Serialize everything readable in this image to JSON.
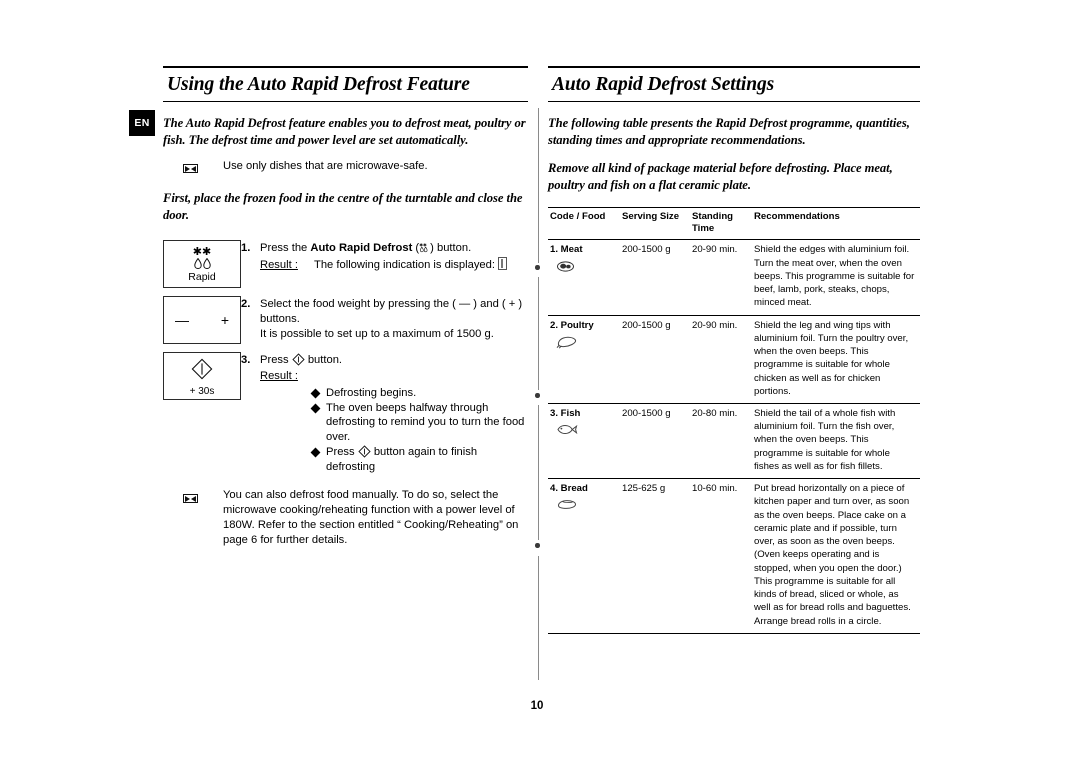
{
  "language_tab": "EN",
  "page_number": "10",
  "left_column": {
    "heading": "Using the Auto Rapid Defrost Feature",
    "intro_1": "The Auto Rapid Defrost feature enables you to defrost meat, poultry or fish. The defrost time and power level are set automatically.",
    "note_1": "Use only dishes that are microwave-safe.",
    "note_1_icon": "microwave-safe-dish-icon",
    "intro_2": "First, place the frozen food in the centre of the turntable and close the door.",
    "steps": [
      {
        "number": "1.",
        "button_icon": "auto-rapid-defrost-button",
        "button_caption": "Rapid",
        "text_before_bold": "Press the ",
        "bold_text": "Auto Rapid Defrost",
        "text_after_bold": " (",
        "text_end": ") button.",
        "result_label": "Result :",
        "result_text": "The following indication is displayed:",
        "result_icon": "lcd-display-glyph"
      },
      {
        "number": "2.",
        "button_icon": "minus-plus-button",
        "minus": "—",
        "plus": "+",
        "line_1a": "Select the food weight by pressing the ( ",
        "line_1b": " ) and ( ",
        "line_1c": " )",
        "line_1d": "buttons.",
        "line_2": "It is possible to set up to a maximum of 1500 g."
      },
      {
        "number": "3.",
        "button_icon": "start-plus-30s-button",
        "button_caption": "+ 30s",
        "text_before": "Press ",
        "text_after": " button.",
        "result_label": "Result :",
        "bullets": [
          "Defrosting begins.",
          "The oven beeps halfway through defrosting to remind you to turn the food over.",
          "Press ◇ button again to finish defrosting"
        ],
        "bullet_3_before": "Press ",
        "bullet_3_after": " button again to finish defrosting"
      }
    ],
    "bottom_note": "You can also defrost food manually. To do so, select the microwave cooking/reheating function with a power level of 180W. Refer to the section entitled “ Cooking/Reheating” on page 6 for further details.",
    "bottom_note_icon": "microwave-safe-dish-icon"
  },
  "right_column": {
    "heading": "Auto Rapid Defrost Settings",
    "intro_1": "The following table presents the Rapid Defrost programme, quantities, standing times and appropriate recommendations.",
    "intro_2": "Remove all kind of package material before defrosting. Place meat, poultry and fish on a flat ceramic plate.",
    "table": {
      "headers": [
        "Code / Food",
        "Serving Size",
        "Standing Time",
        "Recommendations"
      ],
      "rows": [
        {
          "food": "1. Meat",
          "icon": "meat-icon",
          "serving_size": "200-1500 g",
          "standing_time": "20-90 min.",
          "recommendations": "Shield the edges with aluminium foil. Turn the meat over, when the oven beeps. This programme is suitable for beef, lamb, pork, steaks, chops, minced meat."
        },
        {
          "food": "2. Poultry",
          "icon": "poultry-icon",
          "serving_size": "200-1500 g",
          "standing_time": "20-90 min.",
          "recommendations": "Shield the leg and wing tips with aluminium foil. Turn the poultry over, when the oven beeps. This programme is suitable for whole chicken as well as for chicken portions."
        },
        {
          "food": "3. Fish",
          "icon": "fish-icon",
          "serving_size": "200-1500 g",
          "standing_time": "20-80 min.",
          "recommendations": "Shield the tail of a whole fish with aluminium foil. Turn the fish over, when the oven beeps. This programme is suitable for whole fishes as well as for fish fillets."
        },
        {
          "food": "4. Bread",
          "icon": "bread-icon",
          "serving_size": "125-625 g",
          "standing_time": "10-60 min.",
          "recommendations": "Put bread horizontally on a piece of kitchen paper and turn over, as soon as the oven beeps. Place cake on a ceramic plate and if possible, turn over, as soon as the oven beeps. (Oven keeps operating and is stopped, when you open the door.) This programme is suitable for all kinds of bread, sliced or whole, as well as for bread rolls and baguettes. Arrange bread rolls in a circle."
        }
      ]
    }
  },
  "colors": {
    "ink": "#000000",
    "paper": "#ffffff",
    "divider": "#8a8a8a",
    "tab_bg": "#000000",
    "tab_fg": "#ffffff"
  }
}
